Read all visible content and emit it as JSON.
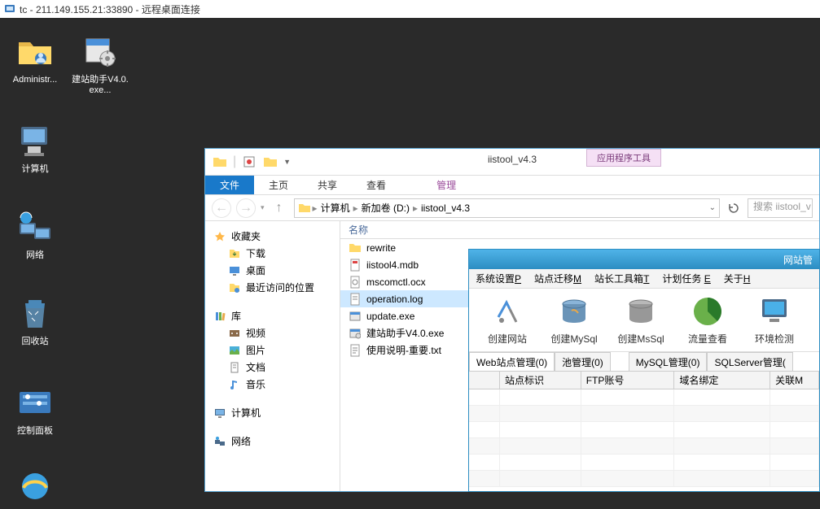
{
  "rdp": {
    "title": "tc - 211.149.155.21:33890 - 远程桌面连接"
  },
  "desktop_icons": [
    {
      "name": "administrator-folder",
      "label": "Administr..."
    },
    {
      "name": "jianzhan-exe",
      "label": "建站助手V4.0.exe..."
    },
    {
      "name": "computer",
      "label": "计算机"
    },
    {
      "name": "network",
      "label": "网络"
    },
    {
      "name": "recycle-bin",
      "label": "回收站"
    },
    {
      "name": "control-panel",
      "label": "控制面板"
    }
  ],
  "explorer": {
    "context_tab": "应用程序工具",
    "title": "iistool_v4.3",
    "ribbon": {
      "file": "文件",
      "home": "主页",
      "share": "共享",
      "view": "查看",
      "manage": "管理"
    },
    "breadcrumb": [
      "计算机",
      "新加卷 (D:)",
      "iistool_v4.3"
    ],
    "search_placeholder": "搜索 iistool_v",
    "nav": {
      "favorites": {
        "label": "收藏夹",
        "items": [
          "下载",
          "桌面",
          "最近访问的位置"
        ]
      },
      "library": {
        "label": "库",
        "items": [
          "视频",
          "图片",
          "文档",
          "音乐"
        ]
      },
      "computer": {
        "label": "计算机"
      },
      "network": {
        "label": "网络"
      }
    },
    "columns": {
      "name": "名称"
    },
    "files": [
      {
        "type": "folder",
        "name": "rewrite"
      },
      {
        "type": "mdb",
        "name": "iistool4.mdb"
      },
      {
        "type": "ocx",
        "name": "mscomctl.ocx"
      },
      {
        "type": "log",
        "name": "operation.log",
        "selected": true
      },
      {
        "type": "exe",
        "name": "update.exe"
      },
      {
        "type": "exe",
        "name": "建站助手V4.0.exe"
      },
      {
        "type": "txt",
        "name": "使用说明-重要.txt"
      }
    ]
  },
  "iistool": {
    "title": "网站管",
    "menu": [
      {
        "label": "系统设置",
        "key": "P"
      },
      {
        "label": "站点迁移",
        "key": "M"
      },
      {
        "label": "站长工具箱",
        "key": "T"
      },
      {
        "label": "计划任务",
        "key": "E"
      },
      {
        "label": "关于",
        "key": "H"
      }
    ],
    "toolbar": [
      {
        "name": "create-site",
        "label": "创建网站"
      },
      {
        "name": "create-mysql",
        "label": "创建MySql"
      },
      {
        "name": "create-mssql",
        "label": "创建MsSql"
      },
      {
        "name": "traffic",
        "label": "流量查看"
      },
      {
        "name": "env-check",
        "label": "环境检测"
      }
    ],
    "tabs": [
      {
        "label": "Web站点管理(0)",
        "active": true
      },
      {
        "label": "池管理(0)"
      },
      {
        "label": "MySQL管理(0)"
      },
      {
        "label": "SQLServer管理("
      }
    ],
    "grid_headers": [
      "",
      "站点标识",
      "FTP账号",
      "域名绑定",
      "关联M"
    ]
  }
}
